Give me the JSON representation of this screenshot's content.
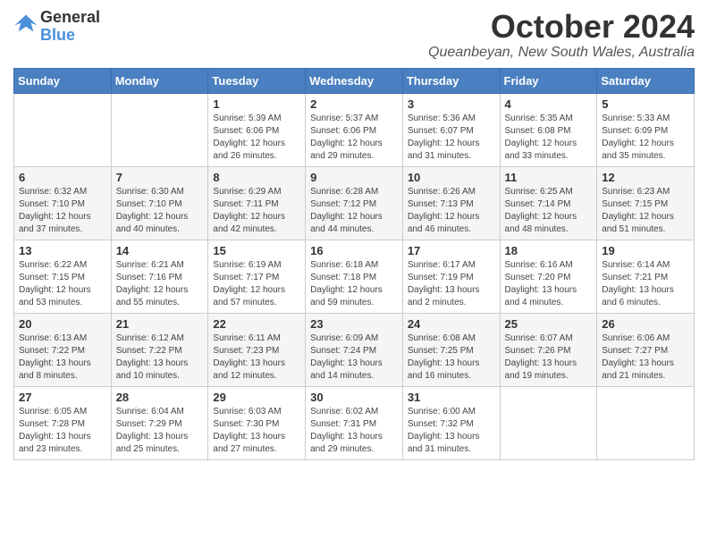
{
  "header": {
    "logo_line1": "General",
    "logo_line2": "Blue",
    "month": "October 2024",
    "location": "Queanbeyan, New South Wales, Australia"
  },
  "weekdays": [
    "Sunday",
    "Monday",
    "Tuesday",
    "Wednesday",
    "Thursday",
    "Friday",
    "Saturday"
  ],
  "weeks": [
    [
      {
        "day": "",
        "info": ""
      },
      {
        "day": "",
        "info": ""
      },
      {
        "day": "1",
        "info": "Sunrise: 5:39 AM\nSunset: 6:06 PM\nDaylight: 12 hours\nand 26 minutes."
      },
      {
        "day": "2",
        "info": "Sunrise: 5:37 AM\nSunset: 6:06 PM\nDaylight: 12 hours\nand 29 minutes."
      },
      {
        "day": "3",
        "info": "Sunrise: 5:36 AM\nSunset: 6:07 PM\nDaylight: 12 hours\nand 31 minutes."
      },
      {
        "day": "4",
        "info": "Sunrise: 5:35 AM\nSunset: 6:08 PM\nDaylight: 12 hours\nand 33 minutes."
      },
      {
        "day": "5",
        "info": "Sunrise: 5:33 AM\nSunset: 6:09 PM\nDaylight: 12 hours\nand 35 minutes."
      }
    ],
    [
      {
        "day": "6",
        "info": "Sunrise: 6:32 AM\nSunset: 7:10 PM\nDaylight: 12 hours\nand 37 minutes."
      },
      {
        "day": "7",
        "info": "Sunrise: 6:30 AM\nSunset: 7:10 PM\nDaylight: 12 hours\nand 40 minutes."
      },
      {
        "day": "8",
        "info": "Sunrise: 6:29 AM\nSunset: 7:11 PM\nDaylight: 12 hours\nand 42 minutes."
      },
      {
        "day": "9",
        "info": "Sunrise: 6:28 AM\nSunset: 7:12 PM\nDaylight: 12 hours\nand 44 minutes."
      },
      {
        "day": "10",
        "info": "Sunrise: 6:26 AM\nSunset: 7:13 PM\nDaylight: 12 hours\nand 46 minutes."
      },
      {
        "day": "11",
        "info": "Sunrise: 6:25 AM\nSunset: 7:14 PM\nDaylight: 12 hours\nand 48 minutes."
      },
      {
        "day": "12",
        "info": "Sunrise: 6:23 AM\nSunset: 7:15 PM\nDaylight: 12 hours\nand 51 minutes."
      }
    ],
    [
      {
        "day": "13",
        "info": "Sunrise: 6:22 AM\nSunset: 7:15 PM\nDaylight: 12 hours\nand 53 minutes."
      },
      {
        "day": "14",
        "info": "Sunrise: 6:21 AM\nSunset: 7:16 PM\nDaylight: 12 hours\nand 55 minutes."
      },
      {
        "day": "15",
        "info": "Sunrise: 6:19 AM\nSunset: 7:17 PM\nDaylight: 12 hours\nand 57 minutes."
      },
      {
        "day": "16",
        "info": "Sunrise: 6:18 AM\nSunset: 7:18 PM\nDaylight: 12 hours\nand 59 minutes."
      },
      {
        "day": "17",
        "info": "Sunrise: 6:17 AM\nSunset: 7:19 PM\nDaylight: 13 hours\nand 2 minutes."
      },
      {
        "day": "18",
        "info": "Sunrise: 6:16 AM\nSunset: 7:20 PM\nDaylight: 13 hours\nand 4 minutes."
      },
      {
        "day": "19",
        "info": "Sunrise: 6:14 AM\nSunset: 7:21 PM\nDaylight: 13 hours\nand 6 minutes."
      }
    ],
    [
      {
        "day": "20",
        "info": "Sunrise: 6:13 AM\nSunset: 7:22 PM\nDaylight: 13 hours\nand 8 minutes."
      },
      {
        "day": "21",
        "info": "Sunrise: 6:12 AM\nSunset: 7:22 PM\nDaylight: 13 hours\nand 10 minutes."
      },
      {
        "day": "22",
        "info": "Sunrise: 6:11 AM\nSunset: 7:23 PM\nDaylight: 13 hours\nand 12 minutes."
      },
      {
        "day": "23",
        "info": "Sunrise: 6:09 AM\nSunset: 7:24 PM\nDaylight: 13 hours\nand 14 minutes."
      },
      {
        "day": "24",
        "info": "Sunrise: 6:08 AM\nSunset: 7:25 PM\nDaylight: 13 hours\nand 16 minutes."
      },
      {
        "day": "25",
        "info": "Sunrise: 6:07 AM\nSunset: 7:26 PM\nDaylight: 13 hours\nand 19 minutes."
      },
      {
        "day": "26",
        "info": "Sunrise: 6:06 AM\nSunset: 7:27 PM\nDaylight: 13 hours\nand 21 minutes."
      }
    ],
    [
      {
        "day": "27",
        "info": "Sunrise: 6:05 AM\nSunset: 7:28 PM\nDaylight: 13 hours\nand 23 minutes."
      },
      {
        "day": "28",
        "info": "Sunrise: 6:04 AM\nSunset: 7:29 PM\nDaylight: 13 hours\nand 25 minutes."
      },
      {
        "day": "29",
        "info": "Sunrise: 6:03 AM\nSunset: 7:30 PM\nDaylight: 13 hours\nand 27 minutes."
      },
      {
        "day": "30",
        "info": "Sunrise: 6:02 AM\nSunset: 7:31 PM\nDaylight: 13 hours\nand 29 minutes."
      },
      {
        "day": "31",
        "info": "Sunrise: 6:00 AM\nSunset: 7:32 PM\nDaylight: 13 hours\nand 31 minutes."
      },
      {
        "day": "",
        "info": ""
      },
      {
        "day": "",
        "info": ""
      }
    ]
  ]
}
